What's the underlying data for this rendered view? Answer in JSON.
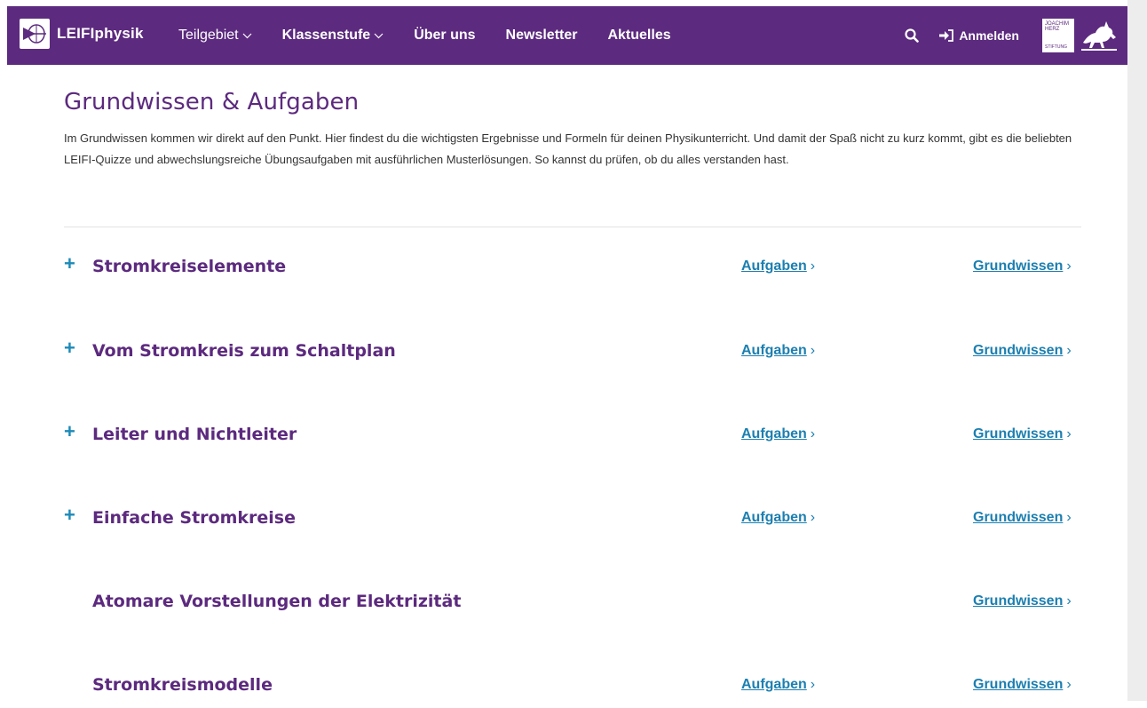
{
  "nav": {
    "brand": "LEIFIphysik",
    "items": [
      {
        "label": "Teilgebiet",
        "has_dropdown": true
      },
      {
        "label": "Klassenstufe",
        "has_dropdown": true
      },
      {
        "label": "Über uns",
        "has_dropdown": false
      },
      {
        "label": "Newsletter",
        "has_dropdown": false
      },
      {
        "label": "Aktuelles",
        "has_dropdown": false
      }
    ],
    "search_icon": "search-icon",
    "login_label": "Anmelden",
    "sponsor_logo": {
      "line1": "JOACHIM",
      "line2": "HERZ",
      "line3": "STIFTUNG"
    },
    "colors": {
      "bar": "#5c2a7e",
      "text": "#ffffff"
    }
  },
  "page": {
    "title": "Grundwissen & Aufgaben",
    "intro": "Im Grundwissen kommen wir direkt auf den Punkt. Hier findest du die wichtigsten Ergebnisse und Formeln für deinen Physikunterricht. Und damit der Spaß nicht zu kurz kommt, gibt es die beliebten LEIFI-Quizze und abwechslungsreiche Übungsaufgaben mit ausführlichen Musterlösungen. So kannst du prüfen, ob du alles verstanden hast."
  },
  "topics": [
    {
      "title": "Stromkreiselemente",
      "expandable": true,
      "aufgaben": "Aufgaben",
      "grundwissen": "Grundwissen"
    },
    {
      "title": "Vom Stromkreis zum Schaltplan",
      "expandable": true,
      "aufgaben": "Aufgaben",
      "grundwissen": "Grundwissen"
    },
    {
      "title": "Leiter und Nichtleiter",
      "expandable": true,
      "aufgaben": "Aufgaben",
      "grundwissen": "Grundwissen"
    },
    {
      "title": "Einfache Stromkreise",
      "expandable": true,
      "aufgaben": "Aufgaben",
      "grundwissen": "Grundwissen"
    },
    {
      "title": "Atomare Vorstellungen der Elektrizität",
      "expandable": false,
      "aufgaben": null,
      "grundwissen": "Grundwissen"
    },
    {
      "title": "Stromkreismodelle",
      "expandable": false,
      "aufgaben": "Aufgaben",
      "grundwissen": "Grundwissen"
    }
  ],
  "symbols": {
    "plus": "+",
    "arrow": "›"
  },
  "colors": {
    "accent": "#5c2a7e",
    "link": "#1c7fb0",
    "plus": "#1d8ab8"
  }
}
